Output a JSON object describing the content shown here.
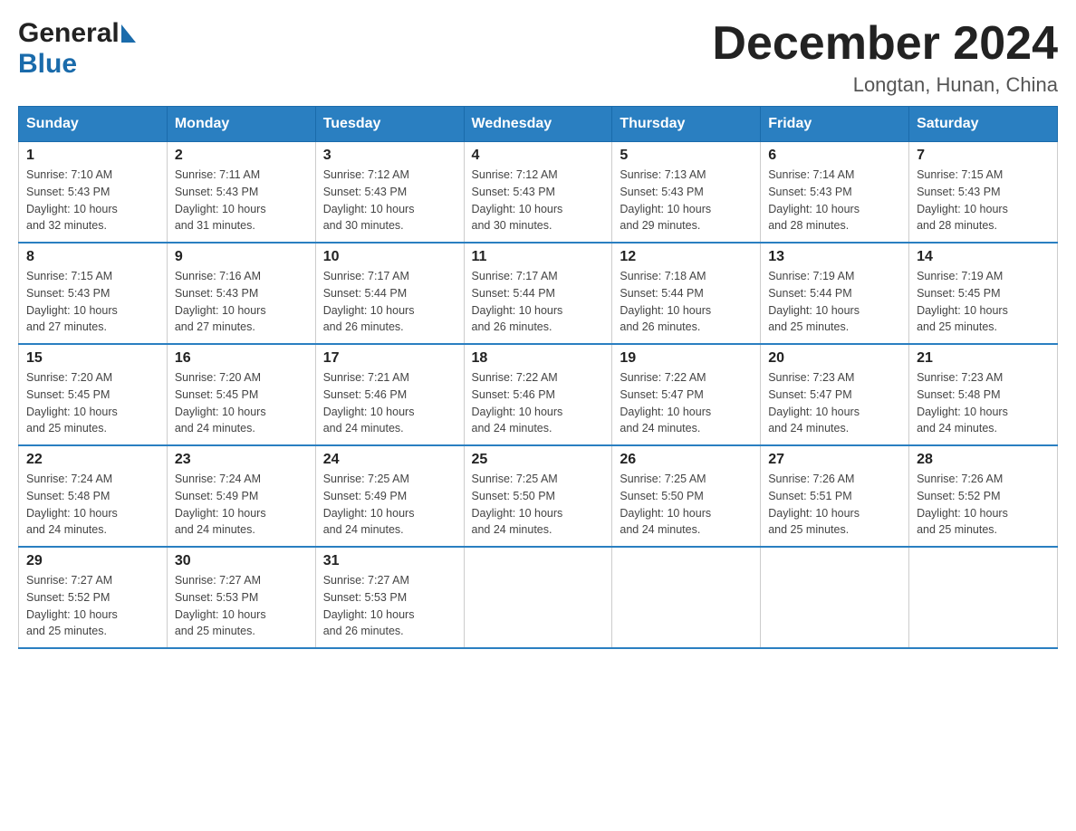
{
  "logo": {
    "general": "General",
    "blue": "Blue",
    "arrow": "▶"
  },
  "title": "December 2024",
  "location": "Longtan, Hunan, China",
  "days_of_week": [
    "Sunday",
    "Monday",
    "Tuesday",
    "Wednesday",
    "Thursday",
    "Friday",
    "Saturday"
  ],
  "weeks": [
    [
      {
        "day": "1",
        "sunrise": "7:10 AM",
        "sunset": "5:43 PM",
        "daylight": "10 hours and 32 minutes."
      },
      {
        "day": "2",
        "sunrise": "7:11 AM",
        "sunset": "5:43 PM",
        "daylight": "10 hours and 31 minutes."
      },
      {
        "day": "3",
        "sunrise": "7:12 AM",
        "sunset": "5:43 PM",
        "daylight": "10 hours and 30 minutes."
      },
      {
        "day": "4",
        "sunrise": "7:12 AM",
        "sunset": "5:43 PM",
        "daylight": "10 hours and 30 minutes."
      },
      {
        "day": "5",
        "sunrise": "7:13 AM",
        "sunset": "5:43 PM",
        "daylight": "10 hours and 29 minutes."
      },
      {
        "day": "6",
        "sunrise": "7:14 AM",
        "sunset": "5:43 PM",
        "daylight": "10 hours and 28 minutes."
      },
      {
        "day": "7",
        "sunrise": "7:15 AM",
        "sunset": "5:43 PM",
        "daylight": "10 hours and 28 minutes."
      }
    ],
    [
      {
        "day": "8",
        "sunrise": "7:15 AM",
        "sunset": "5:43 PM",
        "daylight": "10 hours and 27 minutes."
      },
      {
        "day": "9",
        "sunrise": "7:16 AM",
        "sunset": "5:43 PM",
        "daylight": "10 hours and 27 minutes."
      },
      {
        "day": "10",
        "sunrise": "7:17 AM",
        "sunset": "5:44 PM",
        "daylight": "10 hours and 26 minutes."
      },
      {
        "day": "11",
        "sunrise": "7:17 AM",
        "sunset": "5:44 PM",
        "daylight": "10 hours and 26 minutes."
      },
      {
        "day": "12",
        "sunrise": "7:18 AM",
        "sunset": "5:44 PM",
        "daylight": "10 hours and 26 minutes."
      },
      {
        "day": "13",
        "sunrise": "7:19 AM",
        "sunset": "5:44 PM",
        "daylight": "10 hours and 25 minutes."
      },
      {
        "day": "14",
        "sunrise": "7:19 AM",
        "sunset": "5:45 PM",
        "daylight": "10 hours and 25 minutes."
      }
    ],
    [
      {
        "day": "15",
        "sunrise": "7:20 AM",
        "sunset": "5:45 PM",
        "daylight": "10 hours and 25 minutes."
      },
      {
        "day": "16",
        "sunrise": "7:20 AM",
        "sunset": "5:45 PM",
        "daylight": "10 hours and 24 minutes."
      },
      {
        "day": "17",
        "sunrise": "7:21 AM",
        "sunset": "5:46 PM",
        "daylight": "10 hours and 24 minutes."
      },
      {
        "day": "18",
        "sunrise": "7:22 AM",
        "sunset": "5:46 PM",
        "daylight": "10 hours and 24 minutes."
      },
      {
        "day": "19",
        "sunrise": "7:22 AM",
        "sunset": "5:47 PM",
        "daylight": "10 hours and 24 minutes."
      },
      {
        "day": "20",
        "sunrise": "7:23 AM",
        "sunset": "5:47 PM",
        "daylight": "10 hours and 24 minutes."
      },
      {
        "day": "21",
        "sunrise": "7:23 AM",
        "sunset": "5:48 PM",
        "daylight": "10 hours and 24 minutes."
      }
    ],
    [
      {
        "day": "22",
        "sunrise": "7:24 AM",
        "sunset": "5:48 PM",
        "daylight": "10 hours and 24 minutes."
      },
      {
        "day": "23",
        "sunrise": "7:24 AM",
        "sunset": "5:49 PM",
        "daylight": "10 hours and 24 minutes."
      },
      {
        "day": "24",
        "sunrise": "7:25 AM",
        "sunset": "5:49 PM",
        "daylight": "10 hours and 24 minutes."
      },
      {
        "day": "25",
        "sunrise": "7:25 AM",
        "sunset": "5:50 PM",
        "daylight": "10 hours and 24 minutes."
      },
      {
        "day": "26",
        "sunrise": "7:25 AM",
        "sunset": "5:50 PM",
        "daylight": "10 hours and 24 minutes."
      },
      {
        "day": "27",
        "sunrise": "7:26 AM",
        "sunset": "5:51 PM",
        "daylight": "10 hours and 25 minutes."
      },
      {
        "day": "28",
        "sunrise": "7:26 AM",
        "sunset": "5:52 PM",
        "daylight": "10 hours and 25 minutes."
      }
    ],
    [
      {
        "day": "29",
        "sunrise": "7:27 AM",
        "sunset": "5:52 PM",
        "daylight": "10 hours and 25 minutes."
      },
      {
        "day": "30",
        "sunrise": "7:27 AM",
        "sunset": "5:53 PM",
        "daylight": "10 hours and 25 minutes."
      },
      {
        "day": "31",
        "sunrise": "7:27 AM",
        "sunset": "5:53 PM",
        "daylight": "10 hours and 26 minutes."
      },
      null,
      null,
      null,
      null
    ]
  ],
  "labels": {
    "sunrise_prefix": "Sunrise: ",
    "sunset_prefix": "Sunset: ",
    "daylight_prefix": "Daylight: "
  }
}
